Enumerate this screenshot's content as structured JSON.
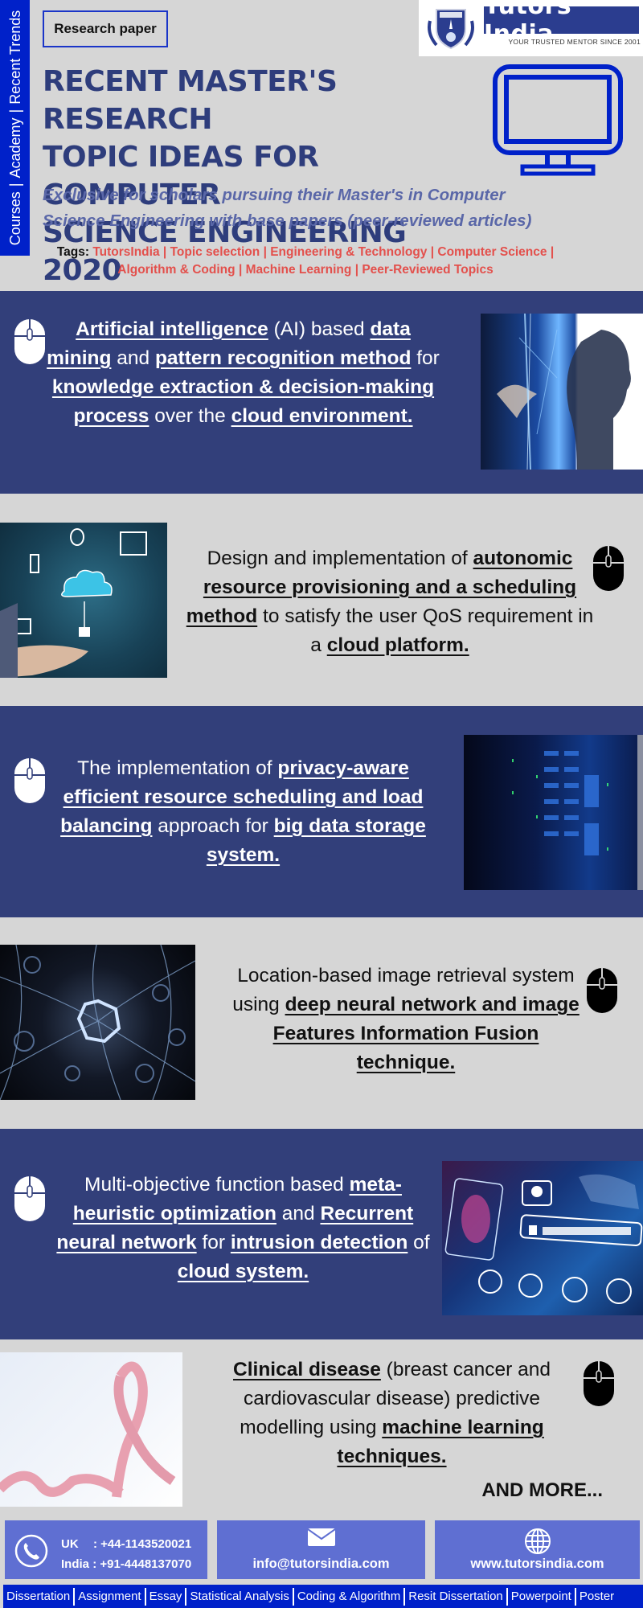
{
  "side_bar": {
    "items": [
      "Courses",
      "Academy",
      "Recent Trends"
    ]
  },
  "header": {
    "category_badge": "Research paper",
    "logo": {
      "brand": "Tutors India",
      "tagline": "YOUR TRUSTED MENTOR SINCE 2001"
    },
    "title_lines": [
      "RECENT MASTER'S RESEARCH",
      "TOPIC IDEAS FOR COMPUTER",
      "SCIENCE ENGINEERING 2020"
    ],
    "subtitle_lines": [
      "Exclusive for scholars pursuing their Master's in Computer",
      "Science Engineering with base papers (peer-reviewed articles)"
    ],
    "tags_label": "Tags:",
    "tags": [
      "TutorsIndia",
      "Topic selection",
      "Engineering & Technology",
      "Computer Science",
      "Algorithm & Coding",
      "Machine Learning",
      "Peer-Reviewed Topics"
    ]
  },
  "topics": [
    {
      "image": "ai-woman-profile-photo",
      "segments": [
        {
          "text": "Artificial intelligence",
          "bold": true
        },
        {
          "text": " (AI) based ",
          "bold": false
        },
        {
          "text": "data mining",
          "bold": true
        },
        {
          "text": " and ",
          "bold": false
        },
        {
          "text": "pattern recognition method",
          "bold": true
        },
        {
          "text": " for ",
          "bold": false
        },
        {
          "text": "knowledge extraction & decision-making process",
          "bold": true
        },
        {
          "text": " over the ",
          "bold": false
        },
        {
          "text": "cloud environment.",
          "bold": true
        }
      ]
    },
    {
      "image": "cloud-network-hand-photo",
      "segments": [
        {
          "text": "Design and implementation of ",
          "bold": false
        },
        {
          "text": "autonomic resource provisioning and a scheduling method",
          "bold": true
        },
        {
          "text": " to satisfy the user QoS requirement in a ",
          "bold": false
        },
        {
          "text": "cloud platform.",
          "bold": true
        }
      ]
    },
    {
      "image": "server-rack-photo",
      "segments": [
        {
          "text": "The implementation of ",
          "bold": false
        },
        {
          "text": "privacy-aware efficient resource scheduling and load balancing",
          "bold": true
        },
        {
          "text": " approach for ",
          "bold": false
        },
        {
          "text": "big data storage system.",
          "bold": true
        }
      ]
    },
    {
      "image": "neural-network-photo",
      "segments": [
        {
          "text": "Location-based image retrieval system using ",
          "bold": false
        },
        {
          "text": "deep neural network and image Features Information Fusion technique.",
          "bold": true
        }
      ]
    },
    {
      "image": "intrusion-detected-photo",
      "segments": [
        {
          "text": "Multi-objective function based ",
          "bold": false
        },
        {
          "text": "meta-heuristic optimization",
          "bold": true
        },
        {
          "text": " and ",
          "bold": false
        },
        {
          "text": "Recurrent neural network",
          "bold": true
        },
        {
          "text": " for ",
          "bold": false
        },
        {
          "text": "intrusion detection",
          "bold": true
        },
        {
          "text": " of ",
          "bold": false
        },
        {
          "text": "cloud system.",
          "bold": true
        }
      ]
    },
    {
      "image": "pink-ribbon-photo",
      "segments": [
        {
          "text": "Clinical disease",
          "bold": true
        },
        {
          "text": " (breast cancer and cardiovascular disease) predictive modelling using ",
          "bold": false
        },
        {
          "text": "machine learning techniques.",
          "bold": true
        }
      ]
    }
  ],
  "and_more": "AND MORE...",
  "contact": {
    "phones": [
      {
        "label": "UK",
        "number": ": +44-1143520021"
      },
      {
        "label": "India",
        "number": ": +91-4448137070"
      }
    ],
    "email": "info@tutorsindia.com",
    "website": "www.tutorsindia.com"
  },
  "bottom_nav": [
    "Dissertation",
    "Assignment",
    "Essay",
    "Statistical Analysis",
    "Coding & Algorithm",
    "Resit Dissertation",
    "Powerpoint",
    "Poster"
  ],
  "colors": {
    "background": "#d6d6d6",
    "dark_section": "#323f7a",
    "accent_blue": "#0021c9",
    "title": "#2e3d7c",
    "subtitle": "#5a67a8",
    "tag": "#e3504c",
    "contact_box": "#5f6fd2"
  }
}
